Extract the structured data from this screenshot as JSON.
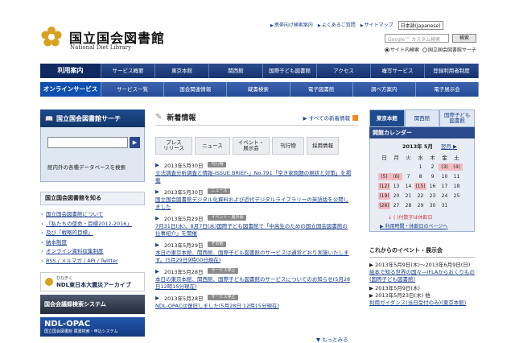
{
  "header": {
    "logo_ja": "国立国会図書館",
    "logo_en": "National Diet Library",
    "util_links": [
      "携帯向け検索案内",
      "よくあるご質問",
      "サイトマップ"
    ],
    "language": "日本語(Japanese)",
    "search_placeholder": "Google™ カスタム検索",
    "search_button": "検索",
    "radio_site": "サイト内検索",
    "radio_ndl": "国立国会図書館サーチ"
  },
  "nav_primary": [
    "利用案内",
    "サービス概要",
    "東京本館",
    "関西館",
    "国際子ども図書館",
    "アクセス",
    "複写サービス",
    "登録利用者制度"
  ],
  "nav_secondary": [
    "オンラインサービス",
    "サービス一覧",
    "国会関連情報",
    "蔵書検索",
    "電子図書館",
    "調べ方案内",
    "電子展示会"
  ],
  "left": {
    "ndl_search_title": "国立国会図書館サーチ",
    "ndl_search_go": "▶",
    "ndl_search_note": "館内外の各種データベースを検索",
    "know_title": "国立国会図書館を知る",
    "know_links": [
      "国立国会図書館について",
      "「私たちの使命・目標2012-2016」",
      "及び「戦略的目標」",
      "納本制度",
      "オンライン資料収集制度",
      "BSS / メルマガ / API / Twitter"
    ],
    "banner_quake_small": "ひなぎく",
    "banner_quake": "NDL東日本大震災アーカイブ",
    "banner_kokkai": "国会会議録検索システム",
    "banner_opac": "NDL-OPAC",
    "banner_opac_small": "国立国会図書館 蔵書検索・申込システム"
  },
  "center": {
    "news_title": "新着情報",
    "news_all": "すべての新着情報",
    "tabs": [
      "プレス\nリリース",
      "ニュース",
      "イベント・\n展示会",
      "刊行物",
      "採用情報"
    ],
    "items": [
      {
        "date": "2013年5月30日",
        "tag": "刊行物",
        "text": "立法調査分析調査と情報-ISSUE BRIEF-」No.791「空き家問題の現状と対策」を掲載"
      },
      {
        "date": "2013年5月30日",
        "tag": "ニュース",
        "text": "国立国会図書館デジタル化資料および近代デジタルライブラリーの英語版を公開しました"
      },
      {
        "date": "2013年5月29日",
        "tag": "イベント・展示会",
        "text": "7月31日(水)、8月7日(水)国際子ども図書館で「中高生のための国立国会図書館の仕事紹介」を開催"
      },
      {
        "date": "2013年5月29日",
        "tag": "その他",
        "text": "本日の東京本館、関西館、国際子ども図書館のサービスは通常どおり実施いたします。(5月29日9時00分現在)"
      },
      {
        "date": "2013年5月28日",
        "tag": "サービス停止",
        "text": "本日の東京本館、関西館、国際子ども図書館のサービスについてのお知らせ(5月28日12時15分現在)"
      },
      {
        "date": "2013年5月28日",
        "tag": "サービス停止",
        "text": "NDL-OPACは復旧しました(5月28日 12時15分現在)"
      }
    ],
    "more": "もっとみる"
  },
  "right": {
    "cal_tabs": [
      "東京本館",
      "関西館",
      "国際子ども\n図書館"
    ],
    "cal_title": "開館カレンダー",
    "cal_month": "2013年 5月",
    "cal_next": "翌月 ▶",
    "dow": [
      "日",
      "月",
      "火",
      "水",
      "木",
      "金",
      "土"
    ],
    "weeks": [
      [
        "",
        "",
        "",
        "1",
        "2",
        "(3)",
        "(4)"
      ],
      [
        "(5)",
        "(6)",
        "7",
        "8",
        "9",
        "10",
        "11"
      ],
      [
        "(12)",
        "13",
        "14",
        "(15)",
        "16",
        "17",
        "18"
      ],
      [
        "(19)",
        "20",
        "21",
        "22",
        "23",
        "24",
        "25"
      ],
      [
        "(26)",
        "27",
        "28",
        "29",
        "30",
        "31",
        ""
      ]
    ],
    "cal_legend": "( )付数字は休館日",
    "cal_hours": "利用時間・休館日のページへ",
    "events_title": "これからのイベント・展示会",
    "events": [
      {
        "date": "2013年5月9日(木)～2013年6月9日(日)",
        "text": "絵本で知る世界の国々—IFLAからおくりもの(国際子ども図書館)"
      },
      {
        "date": "2013年5月9日(木)",
        "text": ""
      },
      {
        "date": "2013年5月23日(木) 他",
        "text": "利用ガイダンス(当日受付のみ)(東京本館)"
      }
    ]
  },
  "colors": {
    "nav_primary": "#1d3c7a",
    "nav_secondary": "#2f58a4",
    "link": "#1a3f8a",
    "closed_day": "#f2bdc2"
  }
}
